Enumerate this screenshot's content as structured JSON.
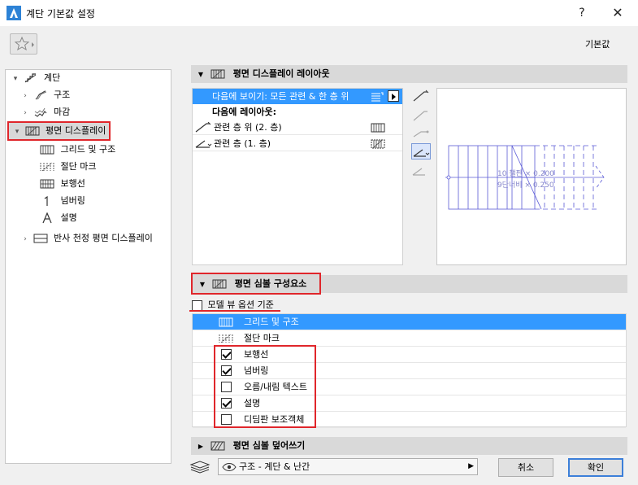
{
  "window": {
    "title": "계단 기본값 설정",
    "help": "?",
    "close": "✕"
  },
  "toolbar": {
    "defaults_label": "기본값"
  },
  "tree": {
    "root": "계단",
    "items": [
      {
        "label": "구조"
      },
      {
        "label": "마감"
      },
      {
        "label": "평면 디스플레이"
      },
      {
        "label": "그리드 및 구조"
      },
      {
        "label": "절단 마크"
      },
      {
        "label": "보행선"
      },
      {
        "label": "넘버링"
      },
      {
        "label": "설명"
      },
      {
        "label": "반사 천정 평면 디스플레이"
      }
    ]
  },
  "floor_plan_layout": {
    "header": "평면 디스플레이 레이아웃",
    "rows": [
      {
        "label": "다음에 보이기: 모든 관련 & 한 층 위"
      },
      {
        "label": "다음에 레이아웃:"
      },
      {
        "label": "관련 층 위 (2. 층)"
      },
      {
        "label": "관련 층 (1. 층)"
      }
    ],
    "preview_text": [
      "10 챌판 × 0.200",
      "9단너비 × 0.250"
    ]
  },
  "symbol_components": {
    "header": "평면 심볼 구성요소",
    "model_view_option": "모델 뷰 옵션 기준",
    "items": [
      {
        "label": "그리드 및 구조"
      },
      {
        "label": "절단 마크"
      },
      {
        "label": "보행선",
        "checked": true
      },
      {
        "label": "넘버링",
        "checked": true
      },
      {
        "label": "오름/내림 텍스트",
        "checked": false
      },
      {
        "label": "설명",
        "checked": true
      },
      {
        "label": "디딤판 보조객체",
        "checked": false
      }
    ]
  },
  "override": {
    "header": "평면 심볼 덮어쓰기"
  },
  "footer": {
    "layer_value": "구조 - 계단 & 난간",
    "cancel": "취소",
    "ok": "확인"
  },
  "colors": {
    "accent": "#3399ff",
    "highlight": "#e0262b"
  }
}
